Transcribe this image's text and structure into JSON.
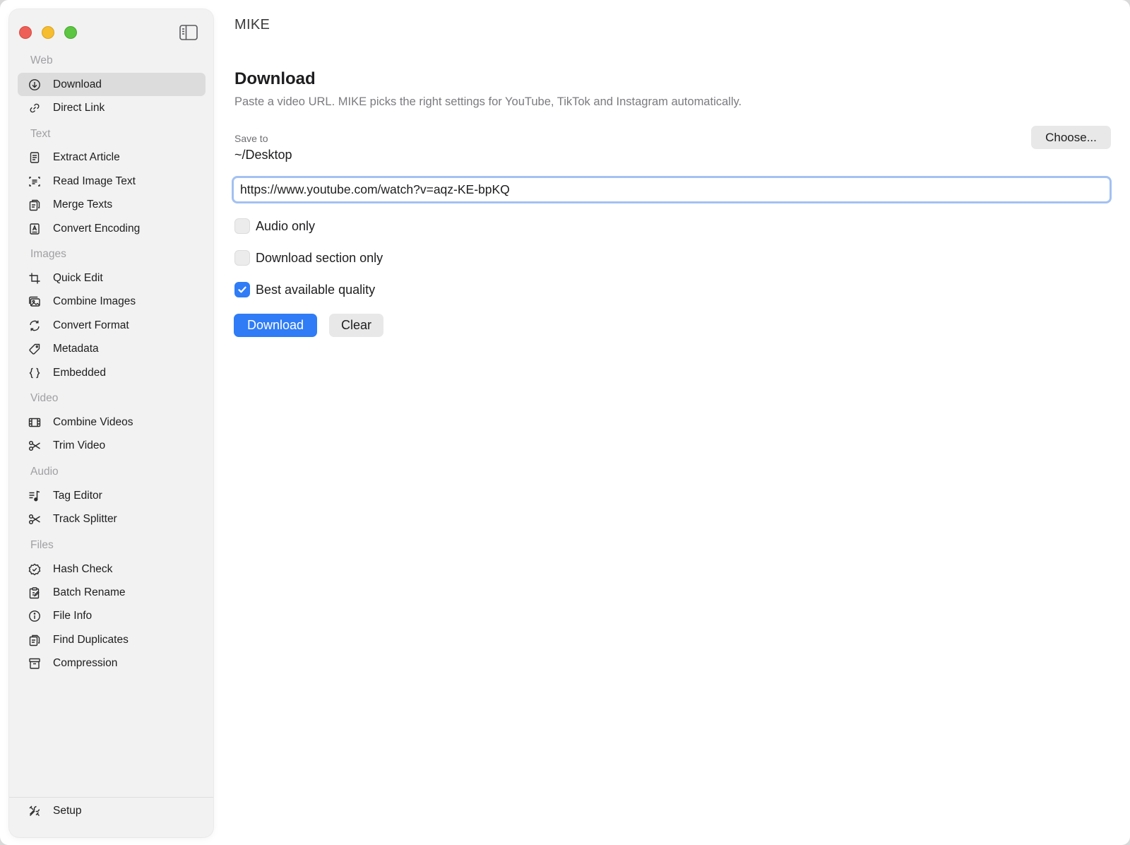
{
  "app": {
    "title": "MIKE"
  },
  "sidebar": {
    "sections": {
      "web": "Web",
      "text": "Text",
      "images": "Images",
      "video": "Video",
      "audio": "Audio",
      "files": "Files"
    },
    "items": {
      "download": {
        "label": "Download",
        "icon": "download-circle-icon",
        "active": true
      },
      "direct_link": {
        "label": "Direct Link",
        "icon": "link-icon"
      },
      "extract_article": {
        "label": "Extract Article",
        "icon": "document-icon"
      },
      "read_image_text": {
        "label": "Read Image Text",
        "icon": "text-scan-icon"
      },
      "merge_texts": {
        "label": "Merge Texts",
        "icon": "documents-merge-icon"
      },
      "convert_encoding": {
        "label": "Convert Encoding",
        "icon": "encoding-icon"
      },
      "quick_edit": {
        "label": "Quick Edit",
        "icon": "crop-icon"
      },
      "combine_images": {
        "label": "Combine Images",
        "icon": "photos-icon"
      },
      "convert_format": {
        "label": "Convert Format",
        "icon": "refresh-icon"
      },
      "metadata": {
        "label": "Metadata",
        "icon": "tag-icon"
      },
      "embedded": {
        "label": "Embedded",
        "icon": "braces-icon"
      },
      "combine_videos": {
        "label": "Combine Videos",
        "icon": "film-icon"
      },
      "trim_video": {
        "label": "Trim Video",
        "icon": "scissors-icon"
      },
      "tag_editor": {
        "label": "Tag Editor",
        "icon": "music-list-icon"
      },
      "track_splitter": {
        "label": "Track Splitter",
        "icon": "scissors-icon"
      },
      "hash_check": {
        "label": "Hash Check",
        "icon": "checkmark-seal-icon"
      },
      "batch_rename": {
        "label": "Batch Rename",
        "icon": "rename-icon"
      },
      "file_info": {
        "label": "File Info",
        "icon": "info-icon"
      },
      "find_duplicates": {
        "label": "Find Duplicates",
        "icon": "duplicate-icon"
      },
      "compression": {
        "label": "Compression",
        "icon": "archive-box-icon"
      }
    },
    "setup": {
      "label": "Setup",
      "icon": "tools-icon"
    }
  },
  "main": {
    "heading": "Download",
    "description": "Paste a video URL. MIKE picks the right settings for YouTube, TikTok and Instagram automatically.",
    "save_to_label": "Save to",
    "save_to_path": "~/Desktop",
    "choose_label": "Choose...",
    "url_value": "https://www.youtube.com/watch?v=aqz-KE-bpKQ",
    "options": {
      "audio_only": {
        "label": "Audio only",
        "checked": false
      },
      "section_only": {
        "label": "Download section only",
        "checked": false
      },
      "best_quality": {
        "label": "Best available quality",
        "checked": true
      }
    },
    "download_button": "Download",
    "clear_button": "Clear"
  },
  "colors": {
    "accent": "#2f7cf6",
    "focus_ring": "#a3c1f2",
    "sidebar_bg": "#f2f2f2",
    "active_item": "#dcdcdc"
  }
}
